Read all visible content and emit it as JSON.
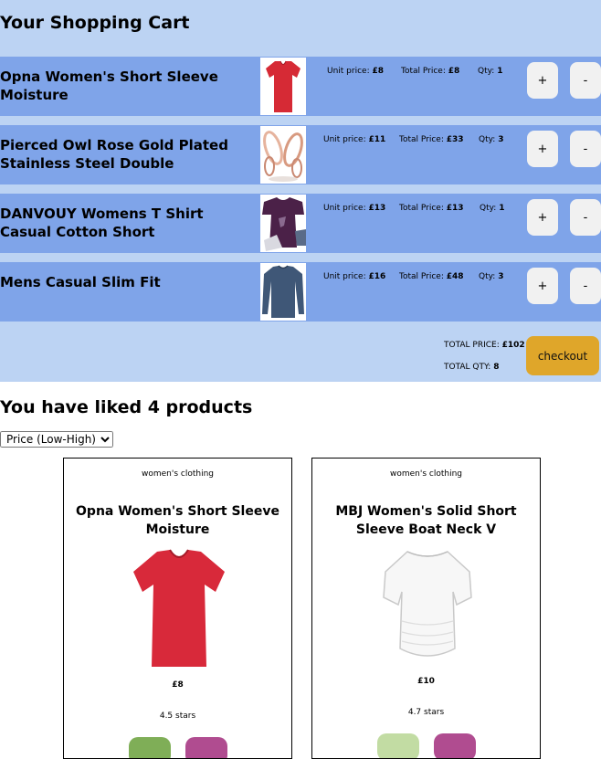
{
  "cart": {
    "title": "Your Shopping Cart",
    "unit_label": "Unit price:",
    "total_label": "Total Price:",
    "qty_label": "Qty:",
    "plus_label": "+",
    "minus_label": "-",
    "items": [
      {
        "name": "Opna Women's Short Sleeve Moisture",
        "unit_price": "£8",
        "total_price": "£8",
        "qty": "1",
        "image": "red-tshirt"
      },
      {
        "name": "Pierced Owl Rose Gold Plated Stainless Steel Double",
        "unit_price": "£11",
        "total_price": "£33",
        "qty": "3",
        "image": "rose-gold-earrings"
      },
      {
        "name": "DANVOUY Womens T Shirt Casual Cotton Short",
        "unit_price": "£13",
        "total_price": "£13",
        "qty": "1",
        "image": "purple-tshirt"
      },
      {
        "name": "Mens Casual Slim Fit",
        "unit_price": "£16",
        "total_price": "£48",
        "qty": "3",
        "image": "navy-longsleeve"
      }
    ],
    "summary": {
      "total_price_label": "TOTAL PRICE:",
      "total_price": "£102",
      "total_qty_label": "TOTAL QTY:",
      "total_qty": "8"
    },
    "checkout_label": "checkout"
  },
  "liked": {
    "title": "You have liked 4 products",
    "sort": {
      "selected": "Price (Low-High)",
      "options": [
        "Price (Low-High)"
      ]
    },
    "products": [
      {
        "category": "women's clothing",
        "name": "Opna Women's Short Sleeve Moisture",
        "price": "£8",
        "rating": "4.5 stars",
        "image": "red-tshirt"
      },
      {
        "category": "women's clothing",
        "name": "MBJ Women's Solid Short Sleeve Boat Neck V",
        "price": "£10",
        "rating": "4.7 stars",
        "image": "white-tshirt"
      }
    ]
  },
  "colors": {
    "cart_background": "#bcd3f3",
    "item_background": "#7fa4e9",
    "checkout": "#dfa62a",
    "card_button_green": "#7fae57",
    "card_button_light_green": "#c2dca3",
    "card_button_magenta": "#b04c90"
  }
}
